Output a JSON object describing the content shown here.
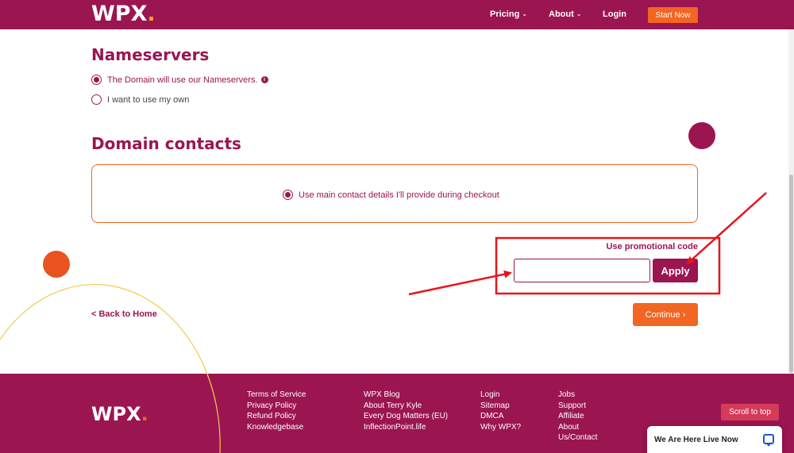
{
  "header": {
    "logo_text": "WPX",
    "logo_dot": ".",
    "nav": {
      "pricing": "Pricing",
      "about": "About",
      "login": "Login",
      "start_now": "Start Now"
    }
  },
  "nameservers": {
    "title": "Nameservers",
    "option_ours": "The Domain will use our Nameservers.",
    "option_own": "I want to use my own",
    "selected": "option_ours"
  },
  "domain_contacts": {
    "title": "Domain contacts",
    "option_main": "Use main contact details I'll provide during checkout"
  },
  "promo": {
    "label": "Use promotional code",
    "input_value": "",
    "apply_label": "Apply"
  },
  "actions": {
    "back_label": "< Back to Home",
    "continue_label": "Continue ›"
  },
  "footer": {
    "logo_text": "WPX",
    "logo_dot": ".",
    "col1": [
      "Terms of Service",
      "Privacy Policy",
      "Refund Policy",
      "Knowledgebase"
    ],
    "col2": [
      "WPX Blog",
      "About Terry Kyle",
      "Every Dog Matters (EU)",
      "InflectionPoint.life"
    ],
    "col3": [
      "Login",
      "Sitemap",
      "DMCA",
      "Why WPX?"
    ],
    "col4": [
      "Jobs",
      "Support",
      "Affiliate",
      "About",
      "Us/Contact"
    ]
  },
  "scroll_top_label": "Scroll to top",
  "chat_label": "We Are Here Live Now",
  "colors": {
    "brand_purple": "#9b1550",
    "brand_orange": "#f26522",
    "logo_dot_yellow": "#f6a623",
    "annotation_red": "#e8141b"
  }
}
